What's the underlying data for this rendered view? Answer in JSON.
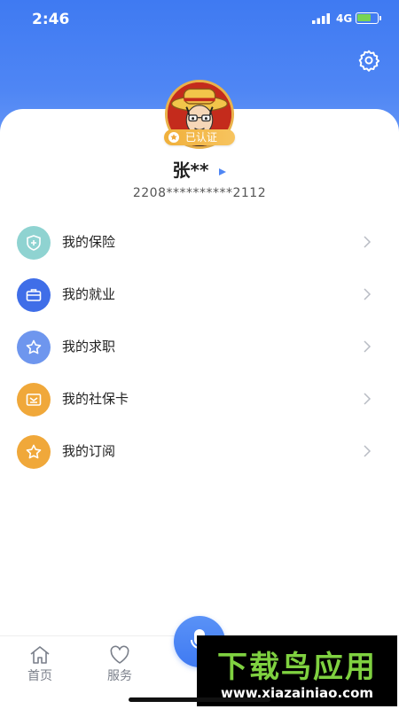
{
  "status_bar": {
    "time": "2:46",
    "network": "4G"
  },
  "profile": {
    "verified_label": "已认证",
    "name": "张**",
    "id_number": "2208**********2112"
  },
  "menu": {
    "items": [
      {
        "label": "我的保险",
        "icon": "shield-plus-icon",
        "color": "#8fd3d1"
      },
      {
        "label": "我的就业",
        "icon": "briefcase-icon",
        "color": "#3f6ee8"
      },
      {
        "label": "我的求职",
        "icon": "star-icon",
        "color": "#6e96ee"
      },
      {
        "label": "我的社保卡",
        "icon": "card-icon",
        "color": "#f0a83a"
      },
      {
        "label": "我的订阅",
        "icon": "star-icon",
        "color": "#f0a83a"
      }
    ]
  },
  "tab_bar": {
    "tabs": [
      {
        "label": "首页",
        "icon": "home-icon"
      },
      {
        "label": "服务",
        "icon": "heart-icon"
      }
    ],
    "mic_icon": "microphone-icon"
  },
  "watermark": {
    "title": "下载鸟应用",
    "url": "www.xiazainiao.com"
  },
  "colors": {
    "accent": "#3f7af2",
    "verified_badge": "#f0b03b"
  }
}
